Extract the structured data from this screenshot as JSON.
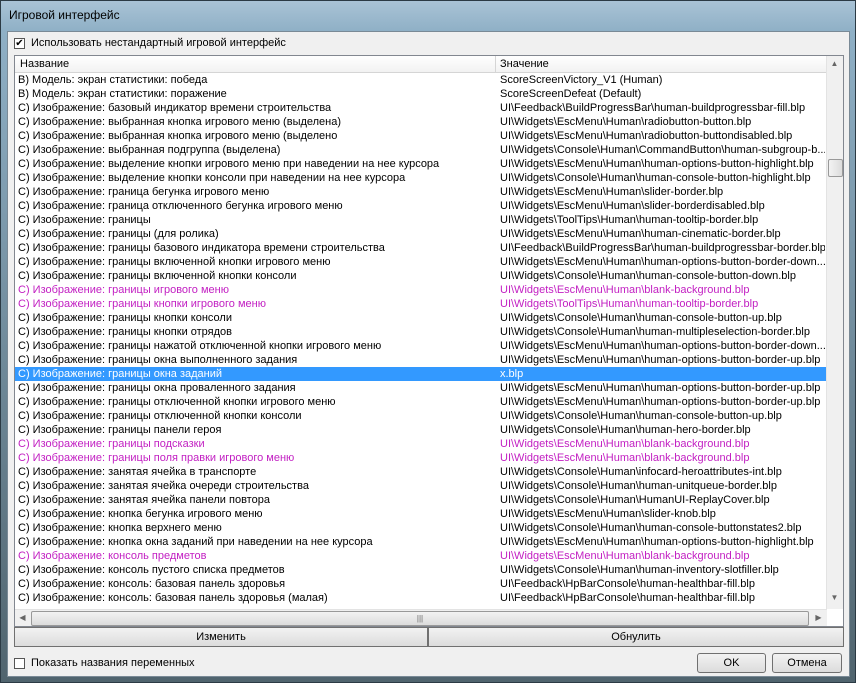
{
  "window": {
    "title": "Игровой интерфейс"
  },
  "use_custom": {
    "label": "Использовать нестандартный игровой интерфейс",
    "checked": true
  },
  "columns": {
    "name": "Название",
    "value": "Значение"
  },
  "rows": [
    {
      "name": "В) Модель: экран статистики: победа",
      "value": "ScoreScreenVictory_V1 (Human)",
      "state": "normal"
    },
    {
      "name": "В) Модель: экран статистики: поражение",
      "value": "ScoreScreenDefeat (Default)",
      "state": "normal"
    },
    {
      "name": "С) Изображение: базовый индикатор времени строительства",
      "value": "UI\\Feedback\\BuildProgressBar\\human-buildprogressbar-fill.blp",
      "state": "normal"
    },
    {
      "name": "С) Изображение: выбранная кнопка игрового меню (выделена)",
      "value": "UI\\Widgets\\EscMenu\\Human\\radiobutton-button.blp",
      "state": "normal"
    },
    {
      "name": "С) Изображение: выбранная кнопка игрового меню (выделено",
      "value": "UI\\Widgets\\EscMenu\\Human\\radiobutton-buttondisabled.blp",
      "state": "normal"
    },
    {
      "name": "С) Изображение: выбранная подгруппа (выделена)",
      "value": "UI\\Widgets\\Console\\Human\\CommandButton\\human-subgroup-b...",
      "state": "normal"
    },
    {
      "name": "С) Изображение: выделение кнопки игрового меню при наведении на нее курсора",
      "value": "UI\\Widgets\\EscMenu\\Human\\human-options-button-highlight.blp",
      "state": "normal"
    },
    {
      "name": "С) Изображение: выделение кнопки консоли при наведении на нее курсора",
      "value": "UI\\Widgets\\Console\\Human\\human-console-button-highlight.blp",
      "state": "normal"
    },
    {
      "name": "С) Изображение: граница бегунка игрового меню",
      "value": "UI\\Widgets\\EscMenu\\Human\\slider-border.blp",
      "state": "normal"
    },
    {
      "name": "С) Изображение: граница отключенного бегунка игрового меню",
      "value": "UI\\Widgets\\EscMenu\\Human\\slider-borderdisabled.blp",
      "state": "normal"
    },
    {
      "name": "С) Изображение: границы",
      "value": "UI\\Widgets\\ToolTips\\Human\\human-tooltip-border.blp",
      "state": "normal"
    },
    {
      "name": "С) Изображение: границы (для ролика)",
      "value": "UI\\Widgets\\EscMenu\\Human\\human-cinematic-border.blp",
      "state": "normal"
    },
    {
      "name": "С) Изображение: границы базового индикатора времени строительства",
      "value": "UI\\Feedback\\BuildProgressBar\\human-buildprogressbar-border.blp",
      "state": "normal"
    },
    {
      "name": "С) Изображение: границы включенной кнопки игрового меню",
      "value": "UI\\Widgets\\EscMenu\\Human\\human-options-button-border-down....",
      "state": "normal"
    },
    {
      "name": "С) Изображение: границы включенной кнопки консоли",
      "value": "UI\\Widgets\\Console\\Human\\human-console-button-down.blp",
      "state": "normal"
    },
    {
      "name": "С) Изображение: границы игрового меню",
      "value": "UI\\Widgets\\EscMenu\\Human\\blank-background.blp",
      "state": "modified"
    },
    {
      "name": "С) Изображение: границы кнопки игрового меню",
      "value": "UI\\Widgets\\ToolTips\\Human\\human-tooltip-border.blp",
      "state": "modified"
    },
    {
      "name": "С) Изображение: границы кнопки консоли",
      "value": "UI\\Widgets\\Console\\Human\\human-console-button-up.blp",
      "state": "normal"
    },
    {
      "name": "С) Изображение: границы кнопки отрядов",
      "value": "UI\\Widgets\\Console\\Human\\human-multipleselection-border.blp",
      "state": "normal"
    },
    {
      "name": "С) Изображение: границы нажатой отключенной кнопки игрового меню",
      "value": "UI\\Widgets\\EscMenu\\Human\\human-options-button-border-down....",
      "state": "normal"
    },
    {
      "name": "С) Изображение: границы окна выполненного задания",
      "value": "UI\\Widgets\\EscMenu\\Human\\human-options-button-border-up.blp",
      "state": "normal"
    },
    {
      "name": "С) Изображение: границы окна заданий",
      "value": "x.blp",
      "state": "selected"
    },
    {
      "name": "С) Изображение: границы окна проваленного задания",
      "value": "UI\\Widgets\\EscMenu\\Human\\human-options-button-border-up.blp",
      "state": "normal"
    },
    {
      "name": "С) Изображение: границы отключенной кнопки игрового меню",
      "value": "UI\\Widgets\\EscMenu\\Human\\human-options-button-border-up.blp",
      "state": "normal"
    },
    {
      "name": "С) Изображение: границы отключенной кнопки консоли",
      "value": "UI\\Widgets\\Console\\Human\\human-console-button-up.blp",
      "state": "normal"
    },
    {
      "name": "С) Изображение: границы панели героя",
      "value": "UI\\Widgets\\Console\\Human\\human-hero-border.blp",
      "state": "normal"
    },
    {
      "name": "С) Изображение: границы подсказки",
      "value": "UI\\Widgets\\EscMenu\\Human\\blank-background.blp",
      "state": "modified"
    },
    {
      "name": "С) Изображение: границы поля правки игрового меню",
      "value": "UI\\Widgets\\EscMenu\\Human\\blank-background.blp",
      "state": "modified"
    },
    {
      "name": "С) Изображение: занятая ячейка в транспорте",
      "value": "UI\\Widgets\\Console\\Human\\infocard-heroattributes-int.blp",
      "state": "normal"
    },
    {
      "name": "С) Изображение: занятая ячейка очереди строительства",
      "value": "UI\\Widgets\\Console\\Human\\human-unitqueue-border.blp",
      "state": "normal"
    },
    {
      "name": "С) Изображение: занятая ячейка панели повтора",
      "value": "UI\\Widgets\\Console\\Human\\HumanUI-ReplayCover.blp",
      "state": "normal"
    },
    {
      "name": "С) Изображение: кнопка бегунка игрового меню",
      "value": "UI\\Widgets\\EscMenu\\Human\\slider-knob.blp",
      "state": "normal"
    },
    {
      "name": "С) Изображение: кнопка верхнего меню",
      "value": "UI\\Widgets\\Console\\Human\\human-console-buttonstates2.blp",
      "state": "normal"
    },
    {
      "name": "С) Изображение: кнопка окна заданий при наведении на нее курсора",
      "value": "UI\\Widgets\\EscMenu\\Human\\human-options-button-highlight.blp",
      "state": "normal"
    },
    {
      "name": "С) Изображение: консоль предметов",
      "value": "UI\\Widgets\\EscMenu\\Human\\blank-background.blp",
      "state": "modified"
    },
    {
      "name": "С) Изображение: консоль пустого списка предметов",
      "value": "UI\\Widgets\\Console\\Human\\human-inventory-slotfiller.blp",
      "state": "normal"
    },
    {
      "name": "С) Изображение: консоль: базовая панель здоровья",
      "value": "UI\\Feedback\\HpBarConsole\\human-healthbar-fill.blp",
      "state": "normal"
    },
    {
      "name": "С) Изображение: консоль: базовая панель здоровья (малая)",
      "value": "UI\\Feedback\\HpBarConsole\\human-healthbar-fill.blp",
      "state": "normal"
    }
  ],
  "buttons": {
    "edit": "Изменить",
    "reset": "Обнулить",
    "ok": "OK",
    "cancel": "Отмена"
  },
  "show_var_names": {
    "label": "Показать названия переменных",
    "checked": false
  },
  "colors": {
    "modified": "#c21fc2",
    "selected": "#3399ff"
  }
}
